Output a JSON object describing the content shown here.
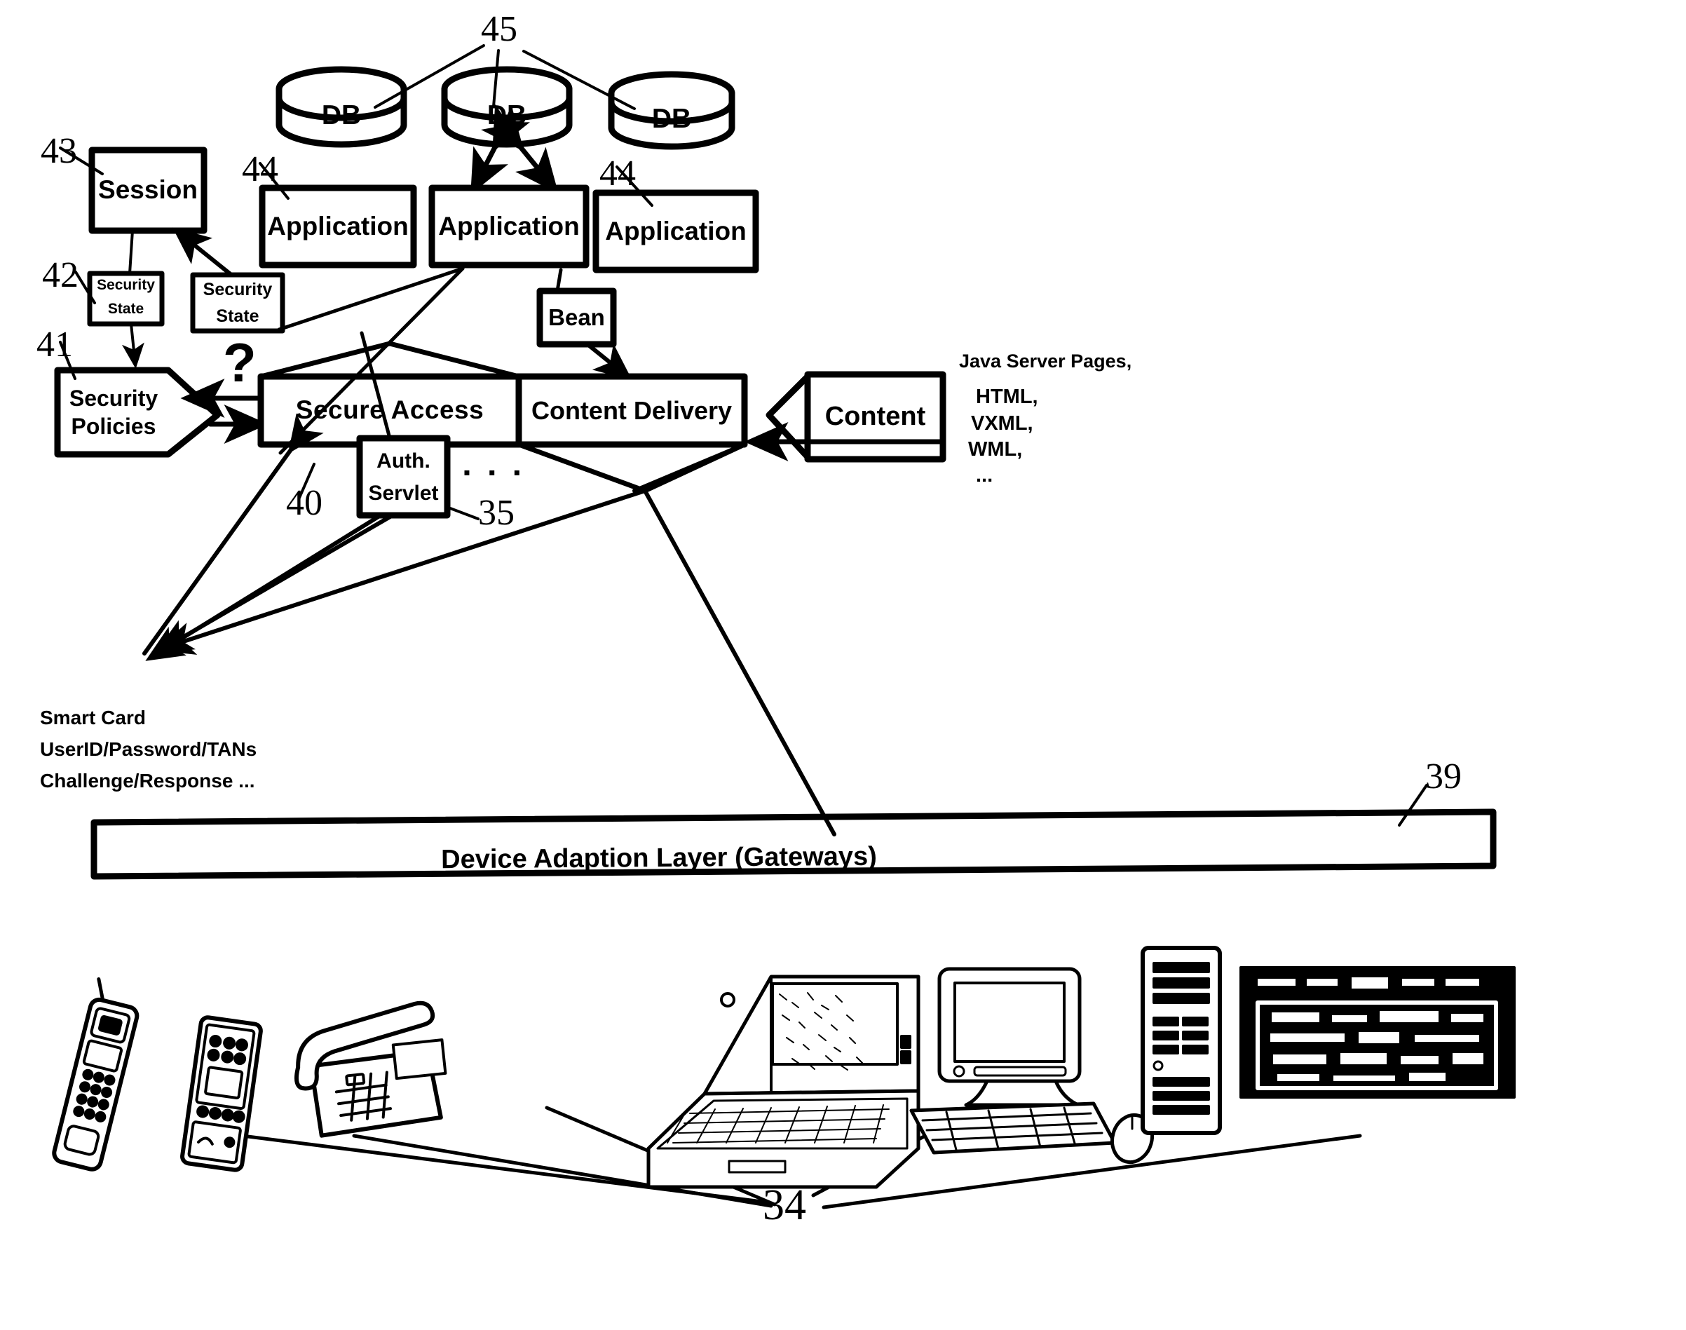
{
  "figure": {
    "type": "patent-architecture-diagram",
    "background_color": "#ffffff",
    "ink_color": "#000000"
  },
  "databases": [
    {
      "label": "DB",
      "ref": "45"
    },
    {
      "label": "DB",
      "ref": "45"
    },
    {
      "label": "DB",
      "ref": "45"
    }
  ],
  "db_group_ref": "45",
  "applications": [
    {
      "label": "Application",
      "ref": "44"
    },
    {
      "label": "Application",
      "ref": "44"
    },
    {
      "label": "Application",
      "ref": "44"
    }
  ],
  "boxes": {
    "session": {
      "label": "Session",
      "ref": "43"
    },
    "security_state_left": {
      "label_line1": "Security",
      "label_line2": "State",
      "ref": "42"
    },
    "security_state_mid": {
      "label_line1": "Security",
      "label_line2": "State"
    },
    "security_policies": {
      "label_line1": "Security",
      "label_line2": "Policies",
      "ref": "41"
    },
    "secure_access": {
      "label": "Secure  Access",
      "ref": "40"
    },
    "auth_servlet": {
      "label_line1": "Auth.",
      "label_line2": "Servlet",
      "ref": "35"
    },
    "content_delivery": {
      "label": "Content Delivery"
    },
    "content": {
      "label": "Content"
    },
    "bean": {
      "label": "Bean"
    },
    "device_adaption_layer": {
      "label": "Device Adaption Layer (Gateways)",
      "ref": "39"
    }
  },
  "annotations": {
    "question_mark": "?",
    "ellipsis_servlets": "▪ ▪ ▪",
    "auth_methods": [
      "Smart Card",
      "UserID/Password/TANs",
      "Challenge/Response ..."
    ],
    "content_formats": [
      "Java Server Pages,",
      "HTML,",
      "VXML,",
      "WML,",
      "..."
    ],
    "devices_ref": "34"
  },
  "reference_numerals": {
    "n34": "34",
    "n35": "35",
    "n39": "39",
    "n40": "40",
    "n41": "41",
    "n42": "42",
    "n43": "43",
    "n44": "44",
    "n45": "45"
  },
  "devices": [
    {
      "name": "mobile-phone"
    },
    {
      "name": "pda"
    },
    {
      "name": "desk-phone"
    },
    {
      "name": "laptop"
    },
    {
      "name": "desktop-computer"
    },
    {
      "name": "television"
    }
  ]
}
